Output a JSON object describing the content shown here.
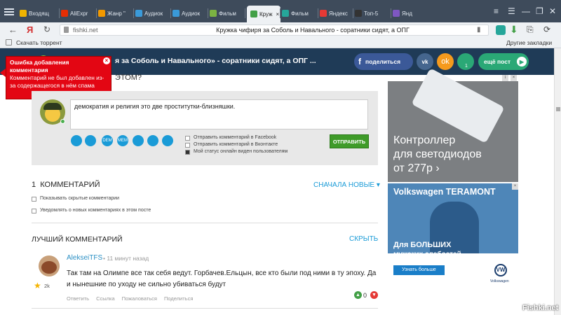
{
  "tabs": [
    {
      "label": "Входящ",
      "icon": "mail-icon",
      "color": "#f0b400"
    },
    {
      "label": "AliExpr",
      "icon": "aliexpress-icon",
      "color": "#e62e04"
    },
    {
      "label": "Жанр \"",
      "icon": "music-icon",
      "color": "#f29900"
    },
    {
      "label": "Аудиок",
      "icon": "headphones-icon",
      "color": "#3a9ad9"
    },
    {
      "label": "Аудиок",
      "icon": "headphones-icon",
      "color": "#3a9ad9"
    },
    {
      "label": "Фильм",
      "icon": "film-icon",
      "color": "#7cb342"
    },
    {
      "label": "Круж",
      "icon": "fishki-icon",
      "color": "#43a047",
      "active": true
    },
    {
      "label": "Фильм",
      "icon": "film-icon",
      "color": "#26a69a"
    },
    {
      "label": "Яндекс",
      "icon": "yandex-icon",
      "color": "#e53935"
    },
    {
      "label": "Топ-5",
      "icon": "plus-icon",
      "color": "#333333"
    },
    {
      "label": "Янд",
      "icon": "video-icon",
      "color": "#7e57c2"
    }
  ],
  "addressbar": {
    "url": "fishki.net",
    "page_title": "Кружка чифиря за Соболь и Навального - соратники сидят, а ОПГ",
    "yandex_letter": "Я"
  },
  "bookmarks": {
    "item": "Скачать торрент",
    "other": "Другие закладки"
  },
  "header": {
    "title": "я за Соболь и Навального» - соратники сидят, а ОПГ ...",
    "share_label": "поделиться",
    "notif_count": "1",
    "next_label": "ещё пост"
  },
  "error": {
    "title": "Ошибка добавления комментария",
    "message": "Комментарий не был добавлен из-за содержащегося в нём спама"
  },
  "prompt_fragment": "ЭТОМ?",
  "comment_form": {
    "text": "демократия и религия это две проститутки-близняшки.",
    "icons": [
      "camera-icon",
      "film-icon",
      "dem-icon",
      "mem-icon",
      "smile-icon",
      "twitter-icon",
      "instagram-icon"
    ],
    "icon_labels": [
      "",
      "",
      "DEM",
      "MEM",
      "",
      "",
      ""
    ],
    "options": [
      {
        "label": "Отправить комментарий в Facebook",
        "checked": false
      },
      {
        "label": "Отправить комментарий в Вконтакте",
        "checked": false
      },
      {
        "label": "Мой статус онлайн виден пользователям",
        "checked": true
      }
    ],
    "submit": "ОТПРАВИТЬ"
  },
  "comments_section": {
    "count": "1",
    "label": "КОММЕНТАРИЙ",
    "sort": "СНАЧАЛА НОВЫЕ",
    "show_hidden": "Показывать скрытые комментарии",
    "notify": "Уведомлять о новых комментариях в этом посте"
  },
  "best": {
    "title": "ЛУЧШИЙ КОММЕНТАРИЙ",
    "hide": "СКРЫТЬ",
    "author": "AlekseiTFS",
    "time": "11 минут назад",
    "rating": "2k",
    "text": "Так там на Олимпе все так себя ведут. Горбачев.Ельцын, все кто были под ними в ту эпоху. Да и нынешние по уходу не сильно убиваться будут",
    "actions": [
      "Ответить",
      "Ссылка",
      "Пожаловаться",
      "Поделиться"
    ],
    "votes": "0"
  },
  "ads": {
    "ad1": {
      "line1": "Контроллер",
      "line2": "для светодиодов",
      "line3": "от 277р ›"
    },
    "ad2": {
      "title": "Volkswagen TERAMONT",
      "line1": "Для БОЛЬШИХ",
      "line2": "мужских слабостей",
      "cta": "Узнать больше",
      "brand": "Volkswagen"
    }
  },
  "watermark": "Fishki.net"
}
